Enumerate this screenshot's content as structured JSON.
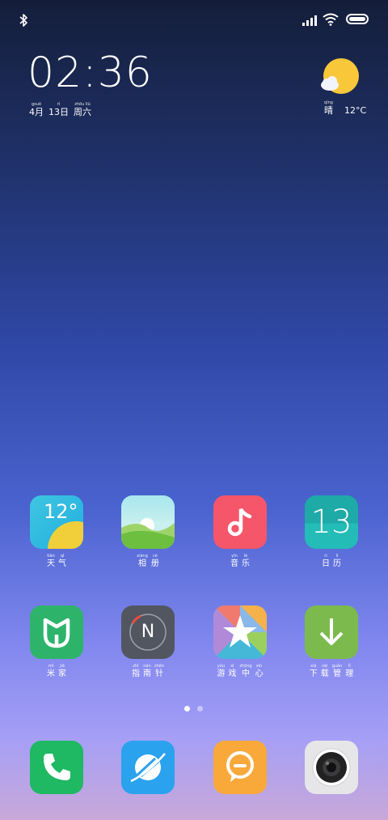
{
  "status_bar": {
    "icons": [
      "bluetooth-icon",
      "signal-icon",
      "wifi-icon",
      "battery-icon"
    ]
  },
  "clock": {
    "time": "02:36",
    "date": [
      {
        "py": "gsuō",
        "hz": "4月"
      },
      {
        "py": "rì",
        "hz": "13日"
      },
      {
        "py": "zhōu liù",
        "hz": "周六"
      }
    ]
  },
  "weather": {
    "icon": "sun-cloud-icon",
    "condition": {
      "py": "qíng",
      "hz": "晴"
    },
    "temp": "12°C"
  },
  "apps_row1": [
    {
      "name": "weather",
      "icon_text": "12°",
      "py": [
        "tiān",
        "qì"
      ],
      "hz": [
        "天",
        "气"
      ]
    },
    {
      "name": "gallery",
      "icon_text": "",
      "py": [
        "xiàng",
        "cè"
      ],
      "hz": [
        "相",
        "册"
      ]
    },
    {
      "name": "music",
      "icon_text": "",
      "py": [
        "yīn",
        "lè"
      ],
      "hz": [
        "音",
        "乐"
      ]
    },
    {
      "name": "calendar",
      "icon_text": "13",
      "py": [
        "rì",
        "lì"
      ],
      "hz": [
        "日",
        "历"
      ]
    }
  ],
  "apps_row2": [
    {
      "name": "mijia",
      "icon_text": "",
      "py": [
        "mǐ",
        "jiā"
      ],
      "hz": [
        "米",
        "家"
      ]
    },
    {
      "name": "compass",
      "icon_text": "N",
      "py": [
        "zhǐ",
        "nán",
        "zhēn"
      ],
      "hz": [
        "指",
        "南",
        "针"
      ]
    },
    {
      "name": "game-center",
      "icon_text": "",
      "py": [
        "yóu",
        "xì",
        "zhōng",
        "xīn"
      ],
      "hz": [
        "游",
        "戏",
        "中",
        "心"
      ]
    },
    {
      "name": "downloads",
      "icon_text": "",
      "py": [
        "xià",
        "zài",
        "guǎn",
        "lǐ"
      ],
      "hz": [
        "下",
        "载",
        "管",
        "理"
      ]
    }
  ],
  "dock": [
    "phone-icon",
    "browser-icon",
    "messages-icon",
    "camera-icon"
  ],
  "page_indicator": {
    "pages": 2,
    "current": 1
  }
}
